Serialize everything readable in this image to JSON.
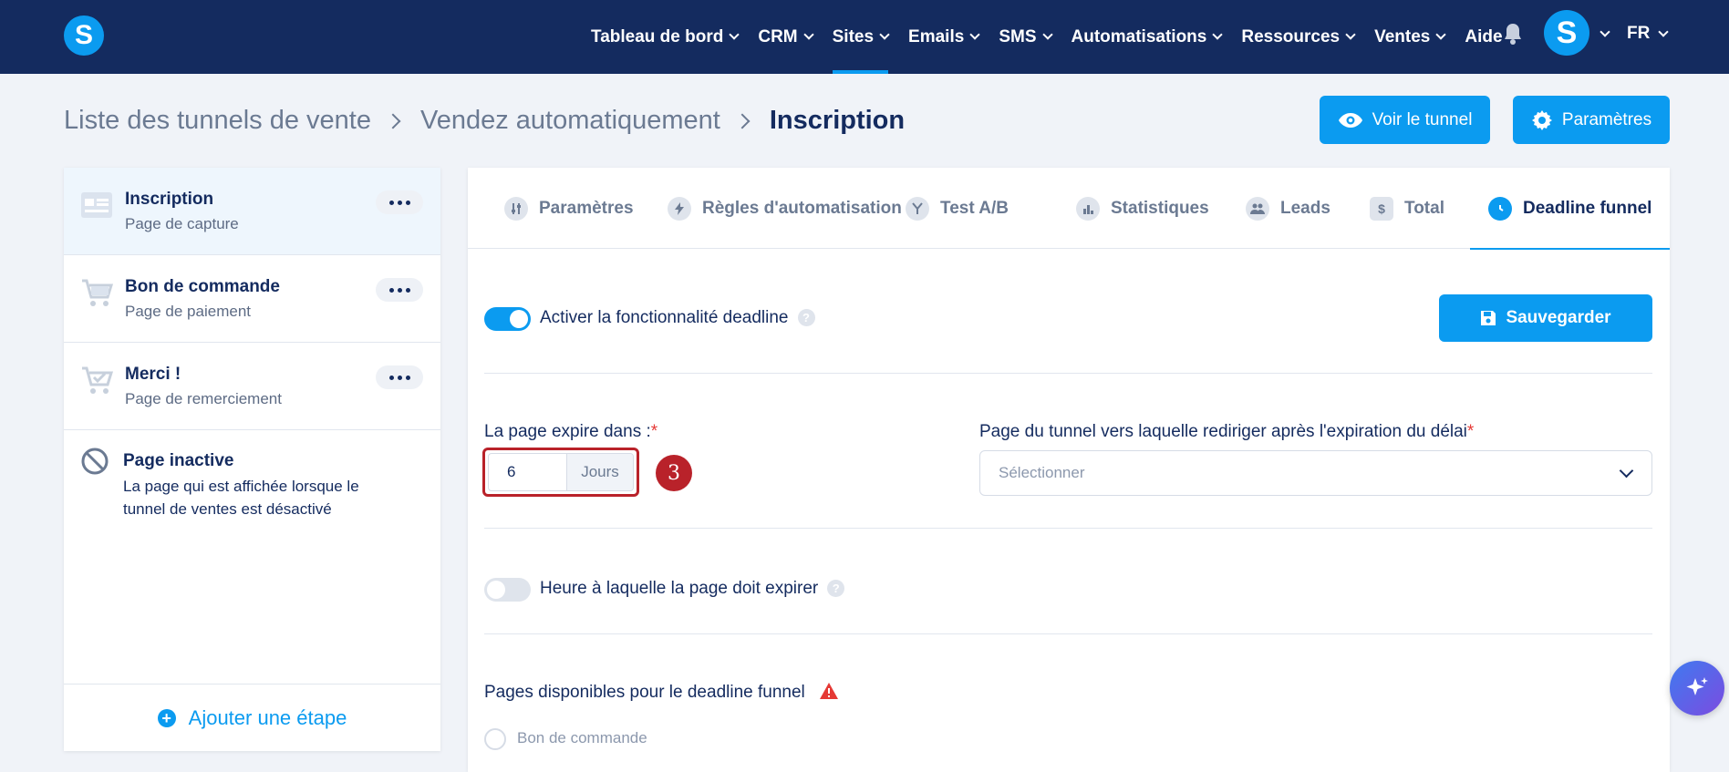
{
  "nav": {
    "items": [
      {
        "label": "Tableau de bord",
        "chevron": true
      },
      {
        "label": "CRM",
        "chevron": true
      },
      {
        "label": "Sites",
        "chevron": true,
        "active": true
      },
      {
        "label": "Emails",
        "chevron": true
      },
      {
        "label": "SMS",
        "chevron": true
      },
      {
        "label": "Automatisations",
        "chevron": true
      },
      {
        "label": "Ressources",
        "chevron": true
      },
      {
        "label": "Ventes",
        "chevron": true
      },
      {
        "label": "Aide",
        "chevron": false
      }
    ],
    "logo_letter": "S",
    "avatar_letter": "S",
    "language": "FR"
  },
  "breadcrumb": {
    "items": [
      "Liste des tunnels de vente",
      "Vendez automatiquement",
      "Inscription"
    ]
  },
  "header_buttons": {
    "view_funnel": "Voir le tunnel",
    "settings": "Paramètres"
  },
  "sidebar": {
    "steps": [
      {
        "title": "Inscription",
        "subtitle": "Page de capture"
      },
      {
        "title": "Bon de commande",
        "subtitle": "Page de paiement"
      },
      {
        "title": "Merci !",
        "subtitle": "Page de remerciement"
      }
    ],
    "inactive": {
      "title": "Page inactive",
      "description": "La page qui est affichée lorsque le tunnel de ventes est désactivé"
    },
    "add_step": "Ajouter une étape"
  },
  "tabs": [
    {
      "label": "Paramètres",
      "icon": "sliders-icon"
    },
    {
      "label": "Règles d'automatisation",
      "icon": "bolt-icon"
    },
    {
      "label": "Test A/B",
      "icon": "split-icon"
    },
    {
      "label": "Statistiques",
      "icon": "bar-chart-icon"
    },
    {
      "label": "Leads",
      "icon": "users-icon"
    },
    {
      "label": "Total",
      "icon": "dollar-icon"
    },
    {
      "label": "Deadline funnel",
      "icon": "clock-icon",
      "active": true
    }
  ],
  "deadline": {
    "enable_label": "Activer la fonctionnalité deadline",
    "enabled": true,
    "save_label": "Sauvegarder",
    "expire_label": "La page expire dans :",
    "required_mark": "*",
    "expire_value": "6",
    "expire_unit": "Jours",
    "step_badge": "3",
    "redirect_label": "Page du tunnel vers laquelle rediriger après l'expiration du délai",
    "redirect_placeholder": "Sélectionner",
    "time_label": "Heure à laquelle la page doit expirer",
    "time_enabled": false,
    "available_label": "Pages disponibles pour le deadline funnel",
    "available_pages": [
      "Bon de commande"
    ],
    "help_mark": "?"
  },
  "colors": {
    "nav_bg": "#142b5f",
    "accent": "#0b9bf0",
    "highlight": "#b9222a"
  }
}
